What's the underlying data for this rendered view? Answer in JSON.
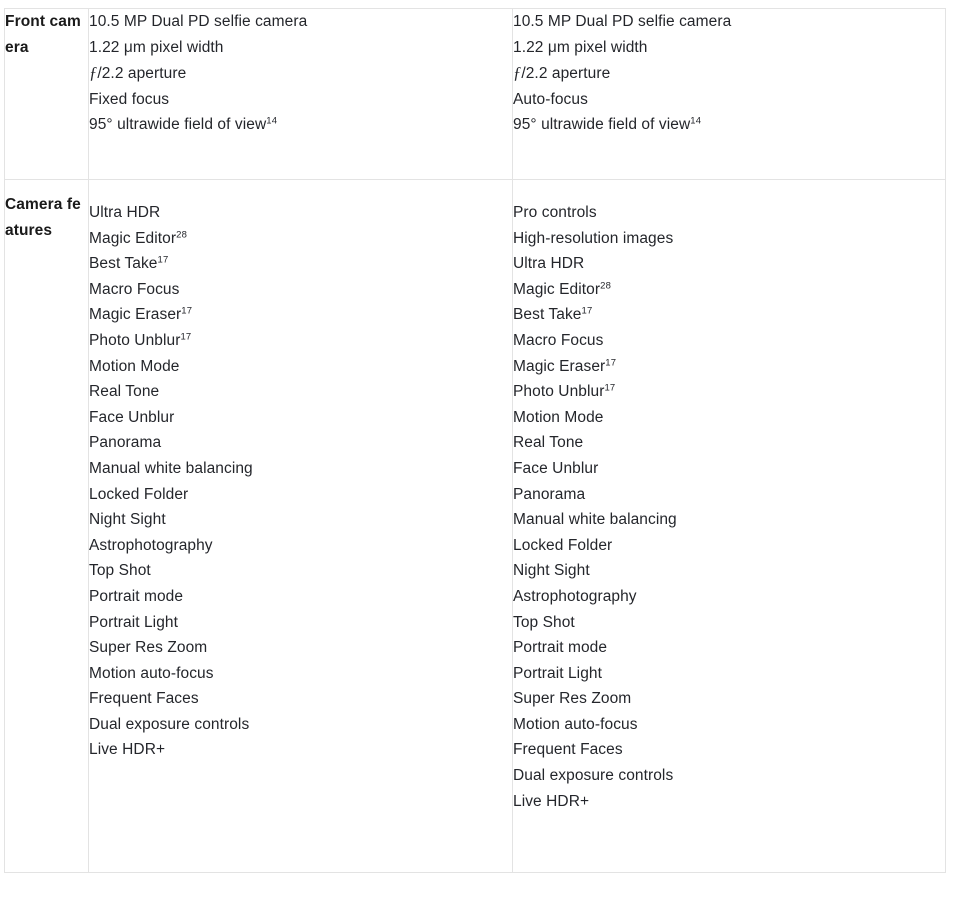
{
  "table": {
    "rows": [
      {
        "label": "Front camera",
        "columns": [
          {
            "lines": [
              {
                "text": "10.5 MP Dual PD selfie camera"
              },
              {
                "text": "1.22 μm pixel width"
              },
              {
                "text": "/2.2 aperture",
                "prefix_italic_f": "ƒ"
              },
              {
                "text": "Fixed focus"
              },
              {
                "text": "95° ultrawide field of view",
                "footnote": "14"
              }
            ]
          },
          {
            "lines": [
              {
                "text": "10.5 MP Dual PD selfie camera"
              },
              {
                "text": "1.22 μm pixel width"
              },
              {
                "text": "/2.2 aperture",
                "prefix_italic_f": "ƒ"
              },
              {
                "text": "Auto-focus"
              },
              {
                "text": "95° ultrawide field of view",
                "footnote": "14"
              }
            ]
          }
        ]
      },
      {
        "label": "Camera features",
        "columns": [
          {
            "lines": [
              {
                "text": "Ultra HDR"
              },
              {
                "text": "Magic Editor",
                "footnote": "28"
              },
              {
                "text": "Best Take",
                "footnote": "17"
              },
              {
                "text": "Macro Focus"
              },
              {
                "text": "Magic Eraser",
                "footnote": "17"
              },
              {
                "text": "Photo Unblur",
                "footnote": "17"
              },
              {
                "text": "Motion Mode"
              },
              {
                "text": "Real Tone"
              },
              {
                "text": "Face Unblur"
              },
              {
                "text": "Panorama"
              },
              {
                "text": "Manual white balancing"
              },
              {
                "text": "Locked Folder"
              },
              {
                "text": "Night Sight"
              },
              {
                "text": "Astrophotography"
              },
              {
                "text": "Top Shot"
              },
              {
                "text": "Portrait mode"
              },
              {
                "text": "Portrait Light"
              },
              {
                "text": "Super Res Zoom"
              },
              {
                "text": "Motion auto-focus"
              },
              {
                "text": "Frequent Faces"
              },
              {
                "text": "Dual exposure controls"
              },
              {
                "text": "Live HDR+"
              }
            ]
          },
          {
            "lines": [
              {
                "text": "Pro controls"
              },
              {
                "text": "High-resolution images"
              },
              {
                "text": "Ultra HDR"
              },
              {
                "text": "Magic Editor",
                "footnote": "28"
              },
              {
                "text": "Best Take",
                "footnote": "17"
              },
              {
                "text": "Macro Focus"
              },
              {
                "text": "Magic Eraser",
                "footnote": "17"
              },
              {
                "text": "Photo Unblur",
                "footnote": "17"
              },
              {
                "text": "Motion Mode"
              },
              {
                "text": "Real Tone"
              },
              {
                "text": "Face Unblur"
              },
              {
                "text": "Panorama"
              },
              {
                "text": "Manual white balancing"
              },
              {
                "text": "Locked Folder"
              },
              {
                "text": "Night Sight"
              },
              {
                "text": "Astrophotography"
              },
              {
                "text": "Top Shot"
              },
              {
                "text": "Portrait mode"
              },
              {
                "text": "Portrait Light"
              },
              {
                "text": "Super Res Zoom"
              },
              {
                "text": "Motion auto-focus"
              },
              {
                "text": "Frequent Faces"
              },
              {
                "text": "Dual exposure controls"
              },
              {
                "text": "Live HDR+"
              }
            ]
          }
        ]
      }
    ]
  },
  "colors": {
    "text": "#24262b",
    "label_text": "#1a1a1a",
    "border": "#e3e3e3",
    "background": "#ffffff"
  }
}
